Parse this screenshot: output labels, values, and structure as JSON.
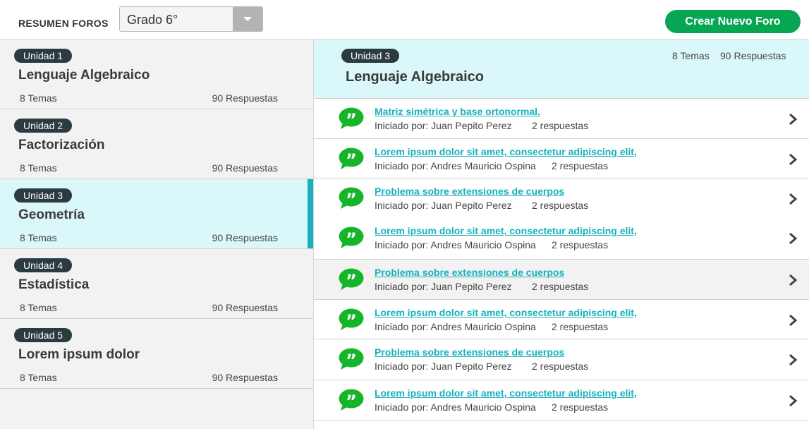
{
  "header": {
    "title": "RESUMEN FOROS",
    "grade_selected": "Grado 6°",
    "create_button": "Crear Nuevo Foro",
    "accent_color": "#07a653"
  },
  "sidebar": {
    "units": [
      {
        "badge": "Unidad 1",
        "name": "Lenguaje Algebraico",
        "temas": "8 Temas",
        "respuestas": "90 Respuestas",
        "active": false
      },
      {
        "badge": "Unidad 2",
        "name": "Factorización",
        "temas": "8 Temas",
        "respuestas": "90 Respuestas",
        "active": false
      },
      {
        "badge": "Unidad 3",
        "name": "Geometría",
        "temas": "8 Temas",
        "respuestas": "90 Respuestas",
        "active": true
      },
      {
        "badge": "Unidad 4",
        "name": "Estadística",
        "temas": "8 Temas",
        "respuestas": "90 Respuestas",
        "active": false
      },
      {
        "badge": "Unidad 5",
        "name": "Lorem ipsum dolor",
        "temas": "8 Temas",
        "respuestas": "90 Respuestas",
        "active": false
      }
    ],
    "active_color": "#18b0bd"
  },
  "main": {
    "badge": "Unidad 3",
    "title": "Lenguaje Algebraico",
    "temas": "8 Temas",
    "respuestas": "90 Respuestas",
    "topics": [
      {
        "title": "Matriz simétrica y base ortonormal.",
        "by": "Iniciado por: Juan Pepito Perez",
        "count": "2 respuestas"
      },
      {
        "title": "Lorem ipsum dolor sit amet, consectetur adipiscing elit,",
        "by": "Iniciado por: Andres Mauricio Ospina",
        "count": "2 respuestas"
      },
      {
        "title": "Problema sobre extensiones de cuerpos",
        "by": "Iniciado por: Juan Pepito Perez",
        "count": "2 respuestas"
      },
      {
        "title": "Lorem ipsum dolor sit amet, consectetur adipiscing elit,",
        "by": "Iniciado por: Andres Mauricio Ospina",
        "count": "2 respuestas"
      },
      {
        "title": "Problema sobre extensiones de cuerpos",
        "by": "Iniciado por: Juan Pepito Perez",
        "count": "2 respuestas"
      },
      {
        "title": "Lorem ipsum dolor sit amet, consectetur adipiscing elit,",
        "by": "Iniciado por: Andres Mauricio Ospina",
        "count": "2 respuestas"
      },
      {
        "title": "Problema sobre extensiones de cuerpos",
        "by": "Iniciado por: Juan Pepito Perez",
        "count": "2 respuestas"
      },
      {
        "title": "Lorem ipsum dolor sit amet, consectetur adipiscing elit,",
        "by": "Iniciado por: Andres Mauricio Ospina",
        "count": "2 respuestas"
      }
    ],
    "topic_icon": "chat-bubble-quote-icon",
    "link_color": "#18b0bd"
  }
}
